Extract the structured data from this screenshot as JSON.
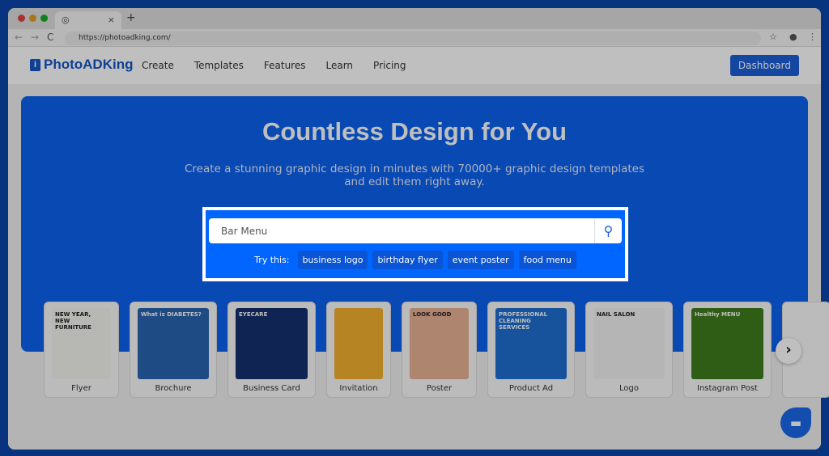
{
  "browser": {
    "url": "https://photoadking.com/",
    "tab_close": "×",
    "new_tab": "+"
  },
  "nav": {
    "logo": "PhotoADKing",
    "items": [
      "Create",
      "Templates",
      "Features",
      "Learn",
      "Pricing"
    ],
    "dashboard": "Dashboard"
  },
  "hero": {
    "title": "Countless Design for You",
    "subtitle": "Create a stunning graphic design in minutes with 70000+ graphic design templates and edit them right away."
  },
  "search": {
    "value": "Bar Menu",
    "try_label": "Try this:",
    "suggestions": [
      "business logo",
      "birthday flyer",
      "event poster",
      "food menu"
    ]
  },
  "categories": [
    {
      "label": "Flyer",
      "thumb": "NEW YEAR, NEW FURNITURE",
      "color": "#f4f4f0"
    },
    {
      "label": "Brochure",
      "thumb": "What is DIABETES?",
      "color": "#2a64b0"
    },
    {
      "label": "Business Card",
      "thumb": "EYECARE",
      "color": "#14306e"
    },
    {
      "label": "Invitation",
      "thumb": "",
      "color": "#f4b030"
    },
    {
      "label": "Poster",
      "thumb": "LOOK GOOD",
      "color": "#e9b294"
    },
    {
      "label": "Product Ad",
      "thumb": "PROFESSIONAL CLEANING SERVICES",
      "color": "#1f6fd0"
    },
    {
      "label": "Logo",
      "thumb": "NAIL SALON",
      "color": "#f2f2f2"
    },
    {
      "label": "Instagram Post",
      "thumb": "Healthy MENU",
      "color": "#3f7d1c"
    }
  ],
  "colors": {
    "accent": "#0066ff",
    "frame": "#0b46aa"
  }
}
